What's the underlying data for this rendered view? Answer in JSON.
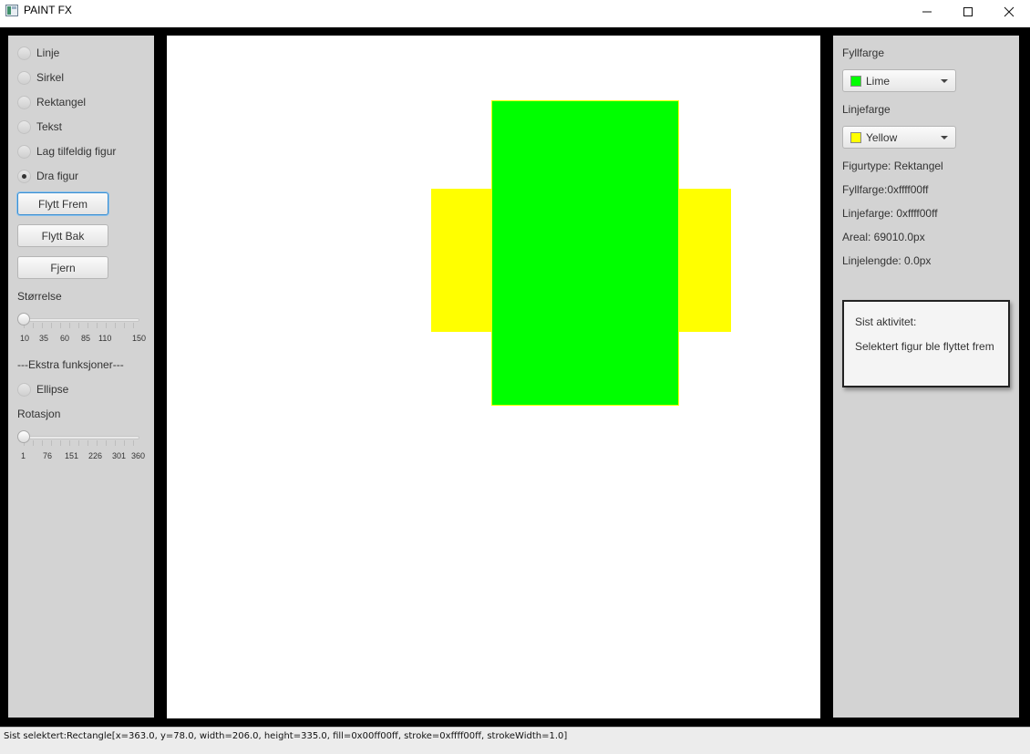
{
  "window": {
    "title": "PAINT FX",
    "minimize": "—",
    "maximize": "☐",
    "close": "✕"
  },
  "left": {
    "radios": [
      {
        "label": "Linje",
        "checked": false
      },
      {
        "label": "Sirkel",
        "checked": false
      },
      {
        "label": "Rektangel",
        "checked": false
      },
      {
        "label": "Tekst",
        "checked": false
      },
      {
        "label": "Lag tilfeldig figur",
        "checked": false
      },
      {
        "label": "Dra figur",
        "checked": true
      }
    ],
    "buttons": {
      "forward": "Flytt Frem",
      "back": "Flytt Bak",
      "remove": "Fjern"
    },
    "size": {
      "label": "Størrelse",
      "ticks": [
        "10",
        "35",
        "60",
        "85",
        "110",
        "150"
      ],
      "value": 10
    },
    "extra_header": "---Ekstra funksjoner---",
    "ellipse": "Ellipse",
    "rotation": {
      "label": "Rotasjon",
      "ticks": [
        "1",
        "76",
        "151",
        "226",
        "301",
        "360"
      ],
      "value": 1
    }
  },
  "canvas": {
    "shapes": [
      {
        "name": "yellow-rectangle",
        "fill": "#ffff00"
      },
      {
        "name": "lime-rectangle",
        "fill": "#00ff00",
        "stroke": "#ffff00"
      }
    ]
  },
  "right": {
    "fill_label": "Fyllfarge",
    "fill_value": "Lime",
    "fill_color": "#00ff00",
    "line_label": "Linjefarge",
    "line_value": "Yellow",
    "line_color": "#ffff00",
    "info": {
      "type": "Figurtype: Rektangel",
      "fill": "Fyllfarge:0xffff00ff",
      "line": "Linjefarge: 0xffff00ff",
      "area": "Areal: 69010.0px",
      "length": "Linjelengde: 0.0px"
    },
    "activity": {
      "title": "Sist aktivitet:",
      "text": "Selektert figur ble flyttet frem"
    }
  },
  "status": "Sist selektert:Rectangle[x=363.0, y=78.0, width=206.0, height=335.0, fill=0x00ff00ff, stroke=0xffff00ff, strokeWidth=1.0]"
}
